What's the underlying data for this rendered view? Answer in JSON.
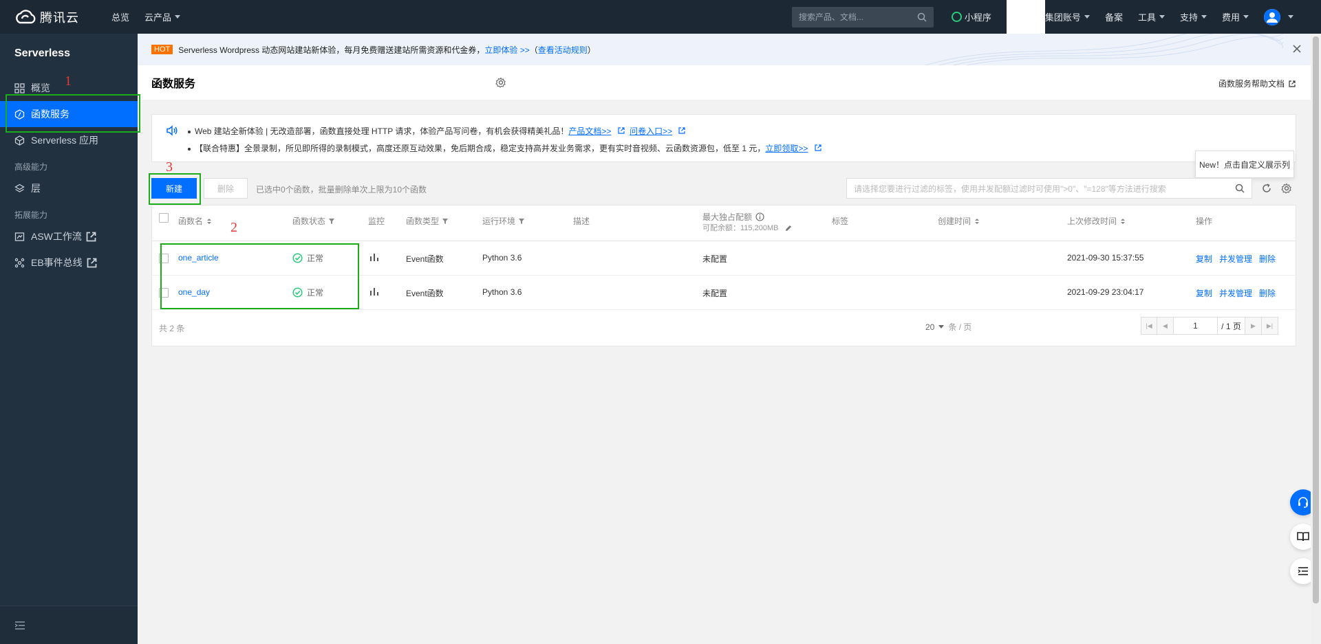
{
  "topbar": {
    "brand": "腾讯云",
    "nav": [
      "总览",
      "云产品"
    ],
    "search_placeholder": "搜索产品、文档...",
    "links": [
      "小程序",
      "集团账号",
      "备案",
      "工具",
      "支持",
      "费用"
    ]
  },
  "sidebar": {
    "title": "Serverless",
    "items": [
      {
        "label": "概览"
      },
      {
        "label": "函数服务"
      },
      {
        "label": "Serverless 应用"
      }
    ],
    "group_advanced": "高级能力",
    "layer": "层",
    "group_extend": "拓展能力",
    "asw": "ASW工作流",
    "eb": "EB事件总线"
  },
  "promo": {
    "hot": "HOT",
    "text": "Serverless Wordpress 动态网站建站新体验，每月免费赠送建站所需资源和代金券，",
    "link1": "立即体验 >>",
    "paren_open": "（",
    "link2": "查看活动规则",
    "paren_close": "）"
  },
  "header": {
    "title": "函数服务",
    "help": "函数服务帮助文档"
  },
  "notice": {
    "line1_text": "Web 建站全新体验 | 无改造部署，函数直接处理 HTTP 请求，体验产品写问卷，有机会获得精美礼品！",
    "line1_link1": "产品文档>>",
    "line1_link2": "问卷入口>>",
    "line2_text": "【联合特惠】全景录制，所见即所得的录制模式，高度还原互动效果，免后期合成，稳定支持高并发业务需求，更有实时音视频、云函数资源包，低至 1 元，",
    "line2_link": "立即领取>>"
  },
  "tooltip": "New！点击自定义展示列",
  "toolbar": {
    "new_label": "新建",
    "delete_label": "删除",
    "selected_info": "已选中0个函数，批量删除单次上限为10个函数",
    "filter_placeholder": "请选择您要进行过滤的标签，使用并发配额过滤时可使用\">0\"、\"=128\"等方法进行搜索"
  },
  "table": {
    "columns": {
      "name": "函数名",
      "status": "函数状态",
      "monitor": "监控",
      "type": "函数类型",
      "runtime": "运行环境",
      "desc": "描述",
      "quota": "最大独占配额",
      "quota_sub": "可配余额：115,200MB",
      "tags": "标签",
      "created": "创建时间",
      "modified": "上次修改时间",
      "actions": "操作"
    },
    "rows": [
      {
        "name": "one_article",
        "status": "正常",
        "type": "Event函数",
        "runtime": "Python 3.6",
        "quota": "未配置",
        "modified": "2021-09-30 15:37:55",
        "copy": "复制",
        "concurrency": "并发管理",
        "delete": "删除"
      },
      {
        "name": "one_day",
        "status": "正常",
        "type": "Event函数",
        "runtime": "Python 3.6",
        "quota": "未配置",
        "modified": "2021-09-29 23:04:17",
        "copy": "复制",
        "concurrency": "并发管理",
        "delete": "删除"
      }
    ],
    "total": "共 2 条",
    "page_size": "20",
    "page_size_unit": "条 / 页",
    "page": "1",
    "page_total": "/ 1 页"
  },
  "annotations": [
    "1",
    "2",
    "3"
  ],
  "colors": {
    "primary": "#006eff",
    "topbar": "#1c2833",
    "sidebar": "#22313f",
    "annotation_box": "#1aad19",
    "annotation_text": "#e53935",
    "success": "#29cc7a"
  }
}
